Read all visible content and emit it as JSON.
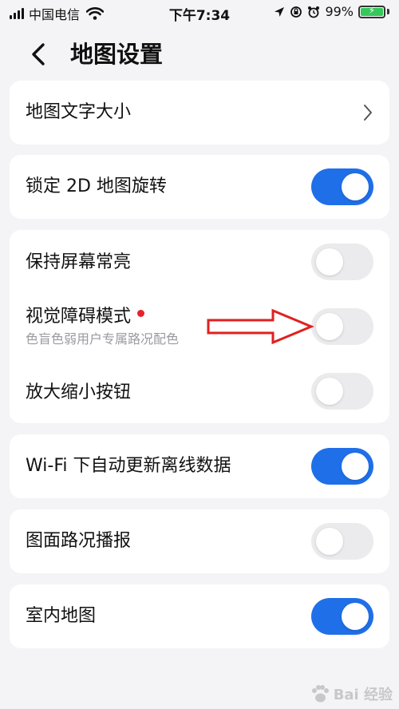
{
  "status_bar": {
    "carrier": "中国电信",
    "time": "下午7:34",
    "battery_percent": "99%",
    "battery_level": 0.99
  },
  "nav": {
    "title": "地图设置"
  },
  "settings": {
    "font_size": {
      "label": "地图文字大小"
    },
    "lock_2d_rotation": {
      "label": "锁定 2D 地图旋转",
      "on": true
    },
    "keep_screen_on": {
      "label": "保持屏幕常亮",
      "on": false
    },
    "visual_impairment_mode": {
      "label": "视觉障碍模式",
      "sub": "色盲色弱用户专属路况配色",
      "on": false,
      "badge": "red-dot"
    },
    "zoom_buttons": {
      "label": "放大缩小按钮",
      "on": false
    },
    "wifi_offline_update": {
      "label": "Wi-Fi 下自动更新离线数据",
      "on": true
    },
    "traffic_broadcast": {
      "label": "图面路况播报",
      "on": false
    },
    "indoor_map": {
      "label": "室内地图",
      "on": true
    }
  },
  "watermark": {
    "text": "Bai 经验"
  },
  "colors": {
    "accent": "#1f6fe8",
    "toggle_off": "#ebebed",
    "annotation": "#e02020",
    "badge": "#e8222a"
  }
}
